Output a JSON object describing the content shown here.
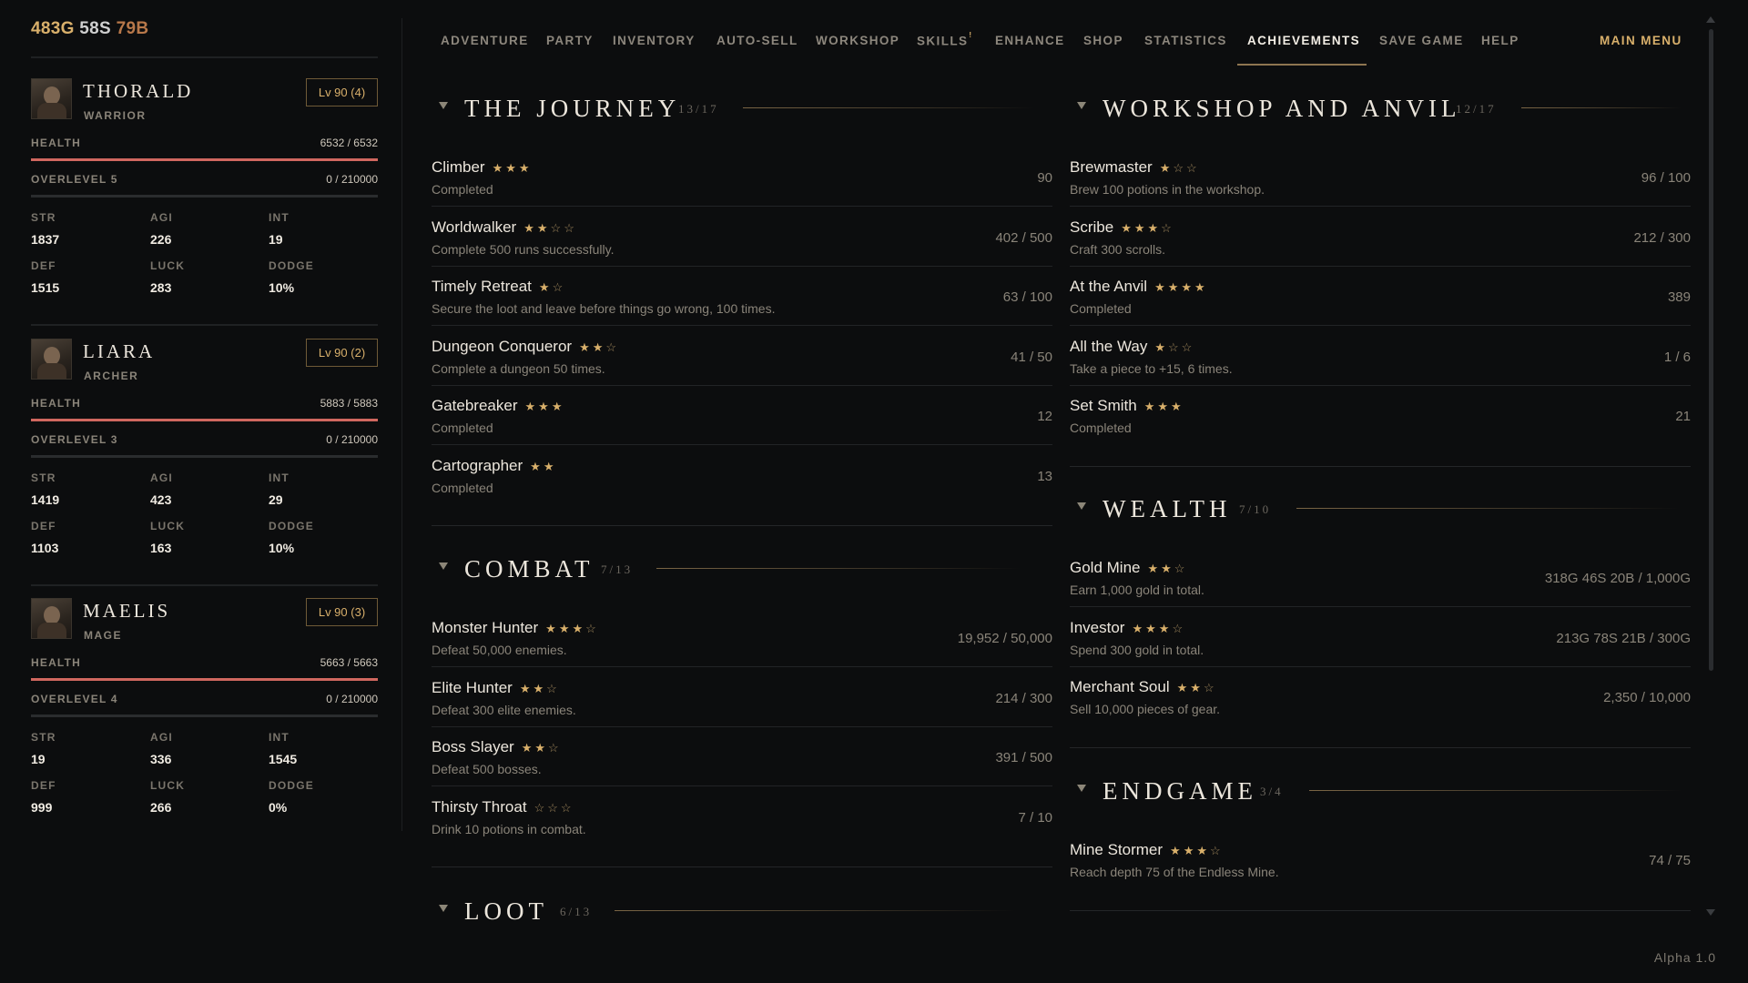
{
  "currency": {
    "gold": "483G",
    "silver": "58S",
    "bronze": "79B"
  },
  "party": [
    {
      "name": "THORALD",
      "class": "WARRIOR",
      "level": "Lv 90 (4)",
      "health_label": "HEALTH",
      "health": "6532 / 6532",
      "health_frac": 1.0,
      "overlevel_label": "OVERLEVEL 5",
      "overlevel": "0 / 210000",
      "overlevel_frac": 0.0,
      "stats": {
        "str_l": "STR",
        "str": "1837",
        "agi_l": "AGI",
        "agi": "226",
        "int_l": "INT",
        "int": "19",
        "def_l": "DEF",
        "def": "1515",
        "luck_l": "LUCK",
        "luck": "283",
        "dodge_l": "DODGE",
        "dodge": "10%"
      }
    },
    {
      "name": "LIARA",
      "class": "ARCHER",
      "level": "Lv 90 (2)",
      "health_label": "HEALTH",
      "health": "5883 / 5883",
      "health_frac": 1.0,
      "overlevel_label": "OVERLEVEL 3",
      "overlevel": "0 / 210000",
      "overlevel_frac": 0.0,
      "stats": {
        "str_l": "STR",
        "str": "1419",
        "agi_l": "AGI",
        "agi": "423",
        "int_l": "INT",
        "int": "29",
        "def_l": "DEF",
        "def": "1103",
        "luck_l": "LUCK",
        "luck": "163",
        "dodge_l": "DODGE",
        "dodge": "10%"
      }
    },
    {
      "name": "MAELIS",
      "class": "MAGE",
      "level": "Lv 90 (3)",
      "health_label": "HEALTH",
      "health": "5663 / 5663",
      "health_frac": 1.0,
      "overlevel_label": "OVERLEVEL 4",
      "overlevel": "0 / 210000",
      "overlevel_frac": 0.0,
      "stats": {
        "str_l": "STR",
        "str": "19",
        "agi_l": "AGI",
        "agi": "336",
        "int_l": "INT",
        "int": "1545",
        "def_l": "DEF",
        "def": "999",
        "luck_l": "LUCK",
        "luck": "266",
        "dodge_l": "DODGE",
        "dodge": "0%"
      }
    }
  ],
  "nav": {
    "items": [
      "ADVENTURE",
      "PARTY",
      "INVENTORY",
      "AUTO-SELL",
      "WORKSHOP",
      "SKILLS",
      "ENHANCE",
      "SHOP",
      "STATISTICS",
      "ACHIEVEMENTS",
      "SAVE GAME",
      "HELP"
    ],
    "skills_badge": "!",
    "active": "ACHIEVEMENTS",
    "main_menu": "MAIN MENU"
  },
  "sections": {
    "journey": {
      "title": "THE JOURNEY",
      "count": "13/17",
      "items": [
        {
          "name": "Climber",
          "stars": 3,
          "desc": "Completed",
          "progress": "90"
        },
        {
          "name": "Worldwalker",
          "stars": 2,
          "desc": "Complete 500 runs successfully.",
          "progress": "402 / 500"
        },
        {
          "name": "Timely Retreat",
          "stars": 1,
          "desc": "Secure the loot and leave before things go wrong, 100 times.",
          "progress": "63 / 100"
        },
        {
          "name": "Dungeon Conqueror",
          "stars": 2,
          "desc": "Complete a dungeon 50 times.",
          "progress": "41 / 50"
        },
        {
          "name": "Gatebreaker",
          "stars": 3,
          "desc": "Completed",
          "progress": "12"
        },
        {
          "name": "Cartographer",
          "stars": 2,
          "desc": "Completed",
          "progress": "13"
        }
      ],
      "total_stars": [
        3,
        4,
        2,
        3,
        3,
        2
      ]
    },
    "combat": {
      "title": "COMBAT",
      "count": "7/13",
      "items": [
        {
          "name": "Monster Hunter",
          "stars": 3,
          "desc": "Defeat 50,000 enemies.",
          "progress": "19,952 / 50,000"
        },
        {
          "name": "Elite Hunter",
          "stars": 2,
          "desc": "Defeat 300 elite enemies.",
          "progress": "214 / 300"
        },
        {
          "name": "Boss Slayer",
          "stars": 2,
          "desc": "Defeat 500 bosses.",
          "progress": "391 / 500"
        },
        {
          "name": "Thirsty Throat",
          "stars": 0,
          "desc": "Drink 10 potions in combat.",
          "progress": "7 / 10"
        }
      ],
      "total_stars": [
        4,
        3,
        3,
        3
      ]
    },
    "loot": {
      "title": "LOOT",
      "count": "6/13"
    },
    "workshop": {
      "title": "WORKSHOP AND ANVIL",
      "count": "12/17",
      "items": [
        {
          "name": "Brewmaster",
          "stars": 1,
          "desc": "Brew 100 potions in the workshop.",
          "progress": "96 / 100"
        },
        {
          "name": "Scribe",
          "stars": 3,
          "desc": "Craft 300 scrolls.",
          "progress": "212 / 300"
        },
        {
          "name": "At the Anvil",
          "stars": 4,
          "desc": "Completed",
          "progress": "389"
        },
        {
          "name": "All the Way",
          "stars": 1,
          "desc": "Take a piece to +15, 6 times.",
          "progress": "1 / 6"
        },
        {
          "name": "Set Smith",
          "stars": 3,
          "desc": "Completed",
          "progress": "21"
        }
      ],
      "total_stars": [
        3,
        4,
        4,
        3,
        3
      ]
    },
    "wealth": {
      "title": "WEALTH",
      "count": "7/10",
      "items": [
        {
          "name": "Gold Mine",
          "stars": 2,
          "desc": "Earn 1,000 gold in total.",
          "progress": "318G 46S 20B / 1,000G"
        },
        {
          "name": "Investor",
          "stars": 3,
          "desc": "Spend 300 gold in total.",
          "progress": "213G 78S 21B / 300G"
        },
        {
          "name": "Merchant Soul",
          "stars": 2,
          "desc": "Sell 10,000 pieces of gear.",
          "progress": "2,350 / 10,000"
        }
      ],
      "total_stars": [
        3,
        4,
        3
      ]
    },
    "endgame": {
      "title": "ENDGAME",
      "count": "3/4",
      "items": [
        {
          "name": "Mine Stormer",
          "stars": 3,
          "desc": "Reach depth 75 of the Endless Mine.",
          "progress": "74 / 75"
        }
      ],
      "total_stars": [
        4
      ]
    }
  },
  "version": "Alpha 1.0",
  "colors": {
    "accent_gold": "#d9b06b",
    "health_bar": "#d0675f",
    "background": "#0c0d0e"
  },
  "icons": {
    "collapse": "triangle-down-icon",
    "star_filled": "★",
    "star_empty": "☆"
  }
}
